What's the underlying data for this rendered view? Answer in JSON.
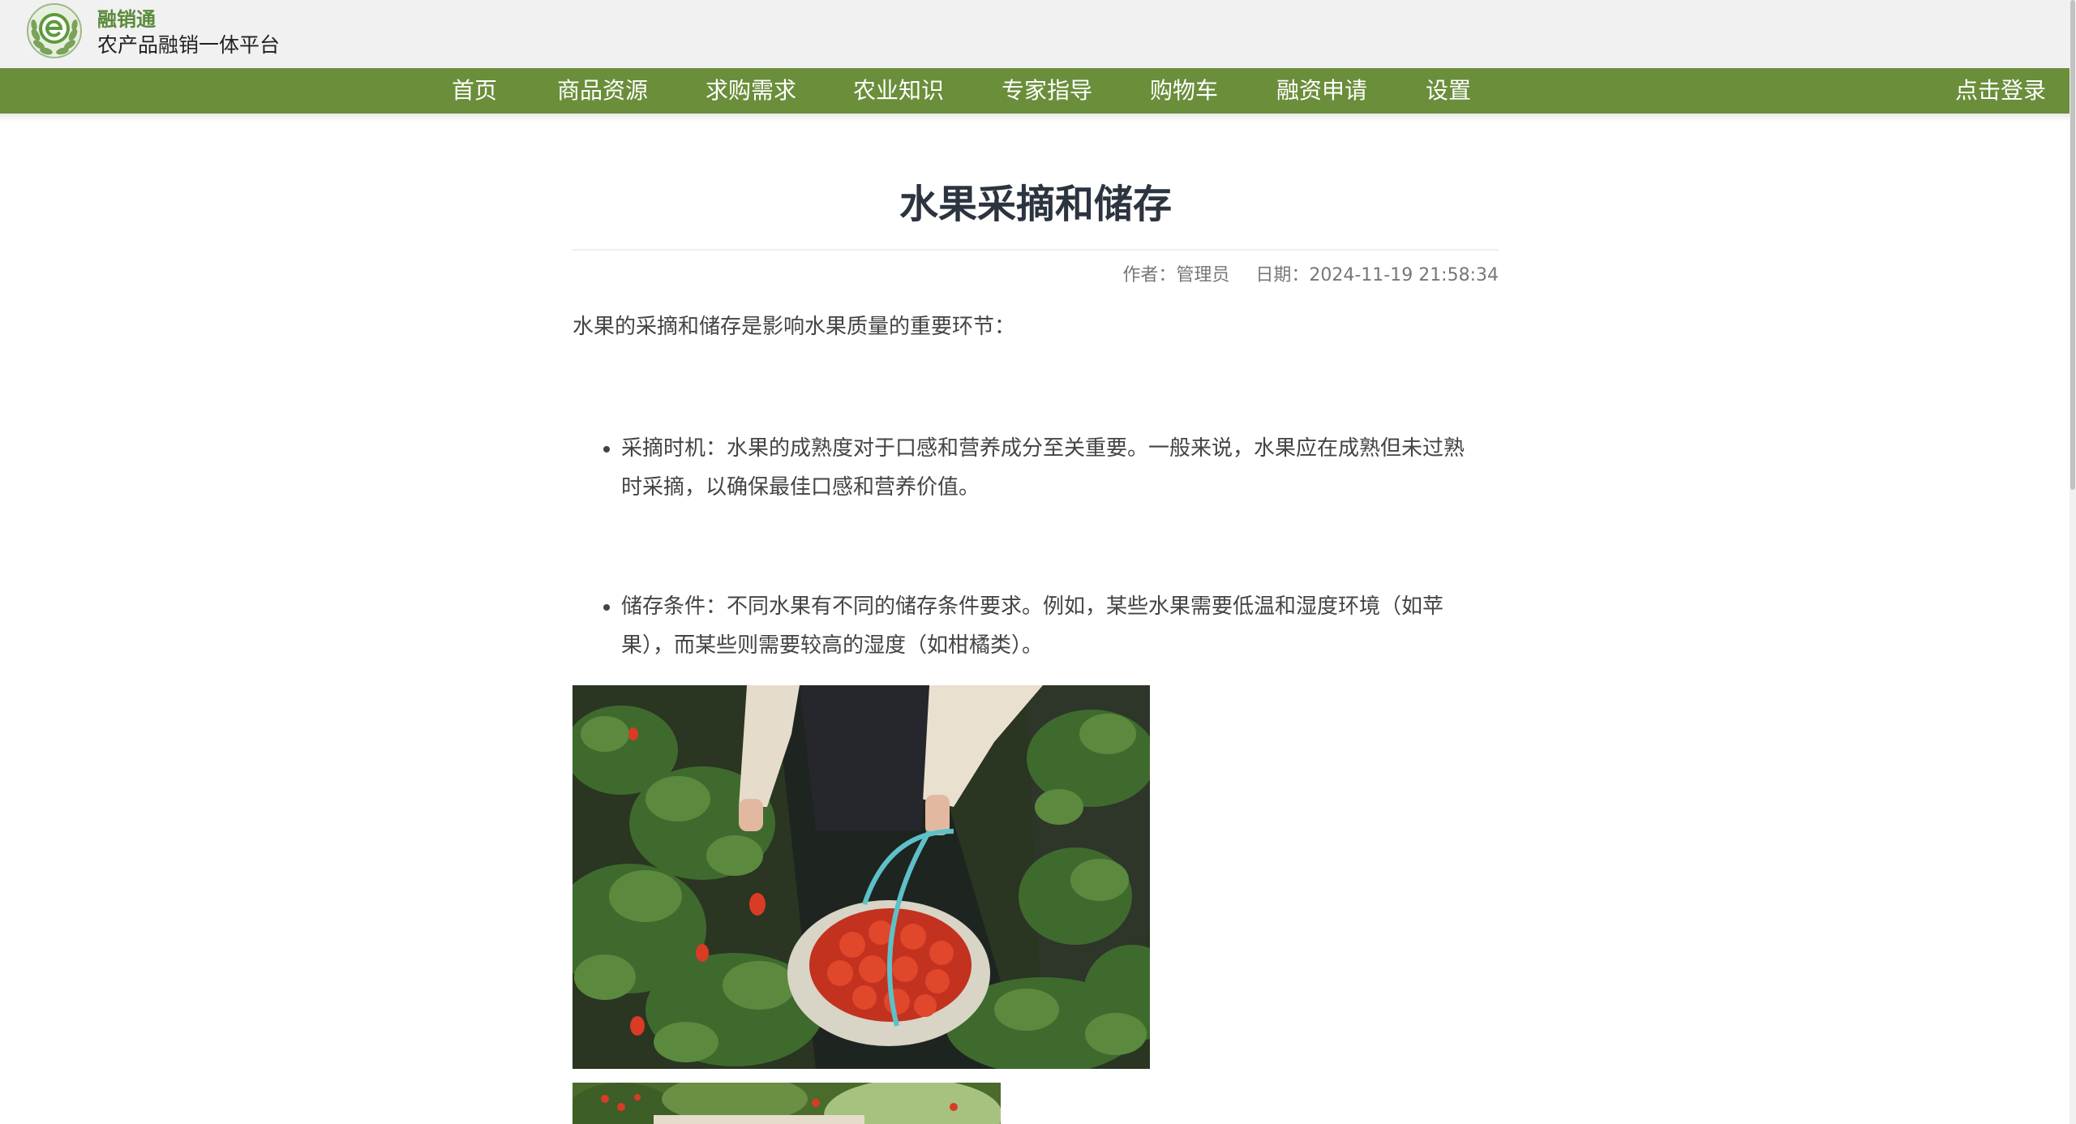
{
  "header": {
    "brand_name": "融销通",
    "brand_subtitle": "农产品融销一体平台"
  },
  "nav": {
    "items": [
      {
        "label": "首页",
        "name": "nav-item-home"
      },
      {
        "label": "商品资源",
        "name": "nav-item-products"
      },
      {
        "label": "求购需求",
        "name": "nav-item-purchase-requests"
      },
      {
        "label": "农业知识",
        "name": "nav-item-agri-knowledge"
      },
      {
        "label": "专家指导",
        "name": "nav-item-expert-guidance"
      },
      {
        "label": "购物车",
        "name": "nav-item-cart"
      },
      {
        "label": "融资申请",
        "name": "nav-item-financing"
      },
      {
        "label": "设置",
        "name": "nav-item-settings"
      }
    ],
    "login_label": "点击登录"
  },
  "article": {
    "title": "水果采摘和储存",
    "author": "作者：管理员",
    "date": "日期：2024-11-19 21:58:34",
    "intro": "水果的采摘和储存是影响水果质量的重要环节：",
    "bullets": [
      "采摘时机：水果的成熟度对于口感和营养成分至关重要。一般来说，水果应在成熟但未过熟时采摘，以确保最佳口感和营养价值。",
      "储存条件：不同水果有不同的储存条件要求。例如，某些水果需要低温和湿度环境（如苹果），而某些则需要较高的湿度（如柑橘类）。"
    ]
  },
  "colors": {
    "nav_background": "#6a8e3a",
    "header_background": "#f1f1f1",
    "brand_green": "#5a8a3a",
    "title_color": "#2c3440",
    "body_text": "#444444"
  }
}
